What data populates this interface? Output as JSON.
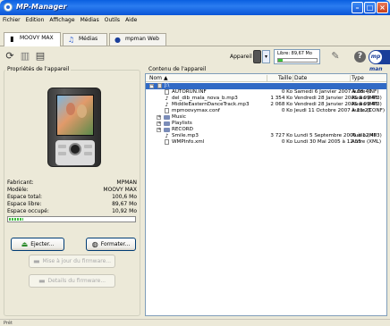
{
  "window": {
    "title": "MP-Manager"
  },
  "menu": [
    "Fichier",
    "Edition",
    "Affichage",
    "Médias",
    "Outils",
    "Aide"
  ],
  "tabs": [
    {
      "label": "MOOVY MAX",
      "icon": "player-icon"
    },
    {
      "label": "Médias",
      "icon": "music-note-icon"
    },
    {
      "label": "mpman Web",
      "icon": "globe-icon"
    }
  ],
  "toolbar": {
    "device_label": "Appareil",
    "free_label": "Libre: 89,67 Mo",
    "free_fraction": 0.12,
    "logo": "mp man"
  },
  "left": {
    "title": "Propriétés de l'appareil",
    "props": [
      {
        "k": "Fabricant:",
        "v": "MPMAN"
      },
      {
        "k": "Modèle:",
        "v": "MOOVY MAX"
      },
      {
        "k": "Espace total:",
        "v": "100,6 Mo"
      },
      {
        "k": "Espace libre:",
        "v": "89,67 Mo"
      },
      {
        "k": "Espace occupé:",
        "v": "10,92 Mo"
      }
    ],
    "used_fraction": 0.11,
    "buttons": {
      "eject": "Ejecter...",
      "format": "Formater...",
      "update": "Mise à jour du firmware...",
      "details": "Details du firmware..."
    }
  },
  "right": {
    "title": "Contenu de l'appareil",
    "headers": {
      "name": "Nom",
      "size": "Taille",
      "date": "Date",
      "type": "Type"
    },
    "root": "J:\\",
    "files": [
      {
        "name": "AUTORUN.INF",
        "size": "0 Ko",
        "date": "Samedi 6 Janvier 2007 à 08:40",
        "type": "Autre (INF)",
        "kind": "doc"
      },
      {
        "name": "del_dib_mala_nova_b.mp3",
        "size": "1 354 Ko",
        "date": "Vendredi 28 Janvier 2005 à 09:45",
        "type": "Audio (MP3)",
        "kind": "audio"
      },
      {
        "name": "MiddleEasternDanceTrack.mp3",
        "size": "2 068 Ko",
        "date": "Vendredi 28 Janvier 2005 à 09:45",
        "type": "Audio (MP3)",
        "kind": "audio"
      },
      {
        "name": "mpmoovymax.conf",
        "size": "0 Ko",
        "date": "Jeudi 11 Octobre 2007 à 11:23",
        "type": "Autre (CONF)",
        "kind": "doc"
      },
      {
        "name": "Music",
        "size": "",
        "date": "",
        "type": "",
        "kind": "folder"
      },
      {
        "name": "Playlists",
        "size": "",
        "date": "",
        "type": "",
        "kind": "folder"
      },
      {
        "name": "RECORD",
        "size": "",
        "date": "",
        "type": "",
        "kind": "folder"
      },
      {
        "name": "Smile.mp3",
        "size": "3 727 Ko",
        "date": "Lundi 5 Septembre 2005 à 12:45",
        "type": "Audio (MP3)",
        "kind": "audio"
      },
      {
        "name": "WMPInfo.xml",
        "size": "0 Ko",
        "date": "Lundi 30 Mai 2005 à 12:55",
        "type": "Autre (XML)",
        "kind": "doc"
      }
    ]
  },
  "status": "Prêt"
}
